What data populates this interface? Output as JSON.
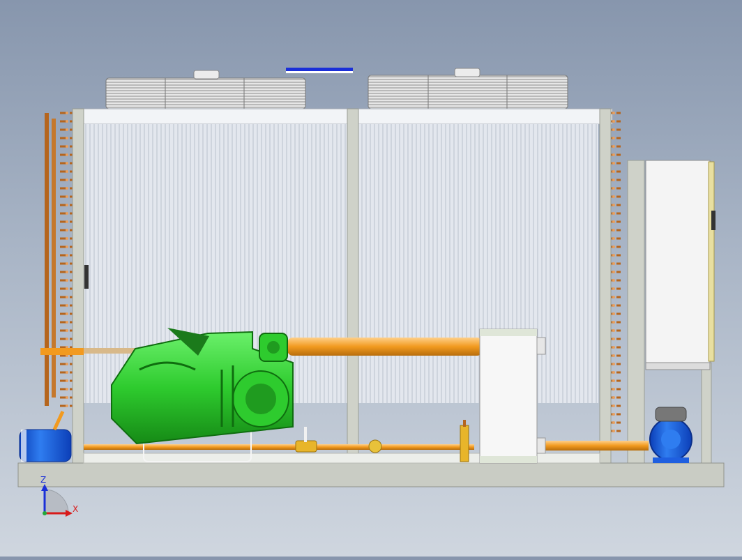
{
  "triad": {
    "z_label": "Z",
    "x_label": "X",
    "z_color": "#1a2fd8",
    "x_color": "#d81a1a",
    "origin_color": "#22a83a"
  },
  "colors": {
    "compressor": "#2ecb2e",
    "pipe": "#f29a1f",
    "copper": "#b5651d",
    "panel": "#dfe4ea",
    "frame": "#c9ccc4",
    "pump": "#1f8be0",
    "receiver": "#1f5fe0",
    "heat_exchanger": "#f5f5f5"
  }
}
